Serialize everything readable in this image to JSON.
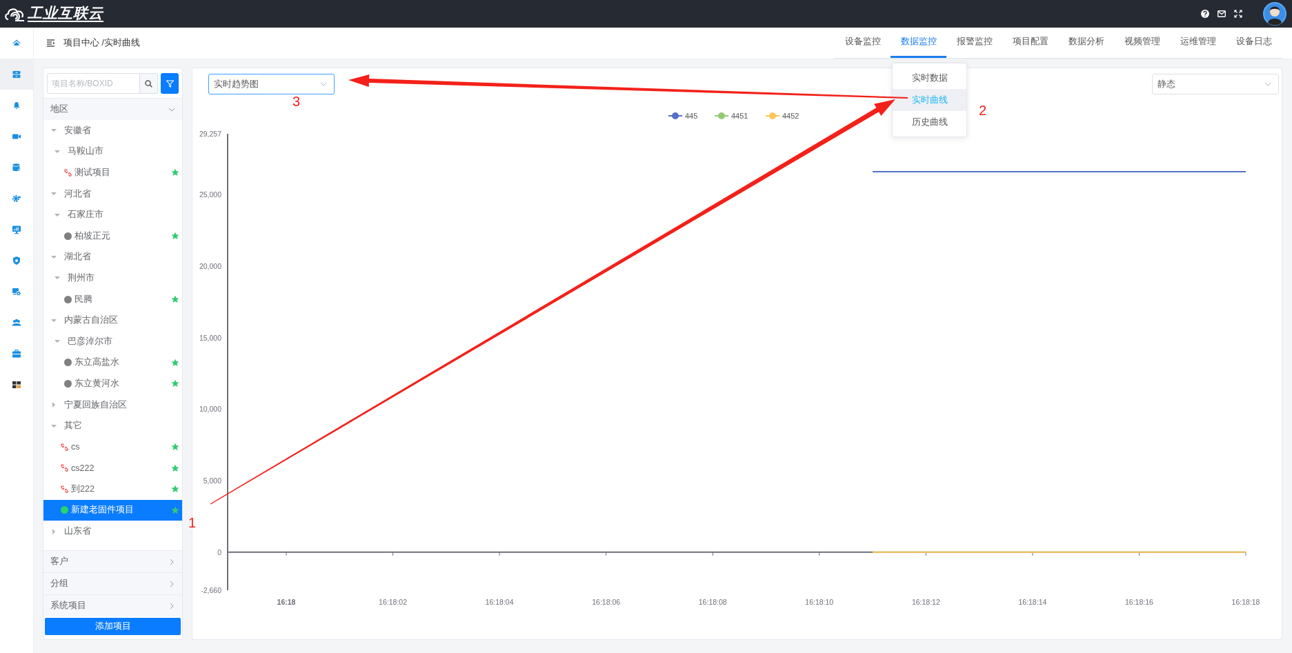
{
  "header": {
    "brand": "工业互联云"
  },
  "rail": [
    {
      "kind": "home",
      "selected": false
    },
    {
      "kind": "cabinet",
      "selected": true
    },
    {
      "kind": "bell",
      "selected": false
    },
    {
      "kind": "video",
      "selected": false
    },
    {
      "kind": "database",
      "selected": false
    },
    {
      "kind": "gear",
      "selected": false
    },
    {
      "kind": "monitor",
      "selected": false
    },
    {
      "kind": "shield",
      "selected": false
    },
    {
      "kind": "monitor-gear",
      "selected": false
    },
    {
      "kind": "users",
      "selected": false
    },
    {
      "kind": "briefcase",
      "selected": false
    },
    {
      "kind": "grid",
      "selected": false
    }
  ],
  "breadcrumb": "项目中心 /实时曲线",
  "nav": {
    "tabs": [
      {
        "label": "设备监控",
        "selected": false
      },
      {
        "label": "数据监控",
        "selected": true,
        "menu": [
          {
            "label": "实时数据",
            "selected": false
          },
          {
            "label": "实时曲线",
            "selected": true
          },
          {
            "label": "历史曲线",
            "selected": false
          }
        ]
      },
      {
        "label": "报警监控",
        "selected": false
      },
      {
        "label": "项目配置",
        "selected": false
      },
      {
        "label": "数据分析",
        "selected": false
      },
      {
        "label": "视频管理",
        "selected": false
      },
      {
        "label": "运维管理",
        "selected": false
      },
      {
        "label": "设备日志",
        "selected": false
      }
    ]
  },
  "tree_panel": {
    "search": {
      "placeholder": "项目名称/BOXID"
    },
    "sections": [
      {
        "title": "地区",
        "expanded": true,
        "nodes": [
          {
            "label": "安徽省",
            "expanded": true,
            "selected": false,
            "children": [
              {
                "label": "马鞍山市",
                "expanded": true,
                "selected": false,
                "children": [
                  {
                    "label": "测试项目",
                    "kind": "unlinked",
                    "starred": true,
                    "selected": false
                  }
                ]
              }
            ]
          },
          {
            "label": "河北省",
            "expanded": true,
            "selected": false,
            "children": [
              {
                "label": "石家庄市",
                "expanded": true,
                "selected": false,
                "children": [
                  {
                    "label": "柏坡正元",
                    "kind": "offline",
                    "starred": true,
                    "selected": false
                  }
                ]
              }
            ]
          },
          {
            "label": "湖北省",
            "expanded": true,
            "selected": false,
            "children": [
              {
                "label": "荆州市",
                "expanded": true,
                "selected": false,
                "children": [
                  {
                    "label": "民腾",
                    "kind": "offline",
                    "starred": true,
                    "selected": false
                  }
                ]
              }
            ]
          },
          {
            "label": "内蒙古自治区",
            "expanded": true,
            "selected": false,
            "children": [
              {
                "label": "巴彦淖尔市",
                "expanded": true,
                "selected": false,
                "children": [
                  {
                    "label": "东立高盐水",
                    "kind": "offline",
                    "starred": true,
                    "selected": false
                  },
                  {
                    "label": "东立黄河水",
                    "kind": "offline",
                    "starred": true,
                    "selected": false
                  }
                ]
              }
            ]
          },
          {
            "label": "宁夏回族自治区",
            "expanded": false,
            "selected": false
          },
          {
            "label": "其它",
            "expanded": true,
            "selected": false,
            "children": [
              {
                "label": "cs",
                "kind": "unlinked",
                "starred": true,
                "selected": false
              },
              {
                "label": "cs222",
                "kind": "unlinked",
                "starred": true,
                "selected": false
              },
              {
                "label": "到222",
                "kind": "unlinked",
                "starred": true,
                "selected": false
              },
              {
                "label": "新建老固件项目",
                "kind": "online",
                "starred": true,
                "selected": true
              }
            ]
          },
          {
            "label": "山东省",
            "expanded": false,
            "selected": false
          }
        ]
      },
      {
        "title": "客户",
        "expanded": false
      },
      {
        "title": "分组",
        "expanded": false
      },
      {
        "title": "系统项目",
        "expanded": false
      }
    ],
    "add_button": "添加项目"
  },
  "chart_card": {
    "view_select": {
      "value": "实时趋势图",
      "focused": true
    },
    "mode_select": {
      "value": "静态",
      "focused": false
    },
    "chart_data": {
      "type": "line",
      "legend": "top",
      "categories": [
        "16:18",
        null,
        "16:18:02",
        null,
        "16:18:04",
        null,
        "16:18:06",
        null,
        "16:18:08",
        null,
        "16:18:10",
        null,
        "16:18:12",
        null,
        "16:18:14",
        null,
        "16:18:16",
        null,
        "16:18:18"
      ],
      "series": [
        {
          "name": "445",
          "color": "#5470c6",
          "values": [
            null,
            null,
            null,
            null,
            null,
            null,
            null,
            null,
            null,
            null,
            null,
            26600,
            26600,
            26600,
            26600,
            26600,
            26600,
            26600,
            26600
          ]
        },
        {
          "name": "4451",
          "color": "#91cc75",
          "values": [
            null,
            null,
            null,
            null,
            null,
            null,
            null,
            null,
            null,
            null,
            null,
            null,
            null,
            null,
            null,
            null,
            null,
            null,
            null
          ]
        },
        {
          "name": "4452",
          "color": "#fac858",
          "values": [
            null,
            null,
            null,
            null,
            null,
            null,
            null,
            null,
            null,
            null,
            null,
            0,
            0,
            0,
            0,
            0,
            0,
            0,
            0
          ]
        }
      ],
      "ylim": [
        -2660,
        29257
      ],
      "yticks": [
        {
          "value": -2660,
          "label": "-2,660"
        },
        {
          "value": 0,
          "label": "0"
        },
        {
          "value": 5000,
          "label": "5,000"
        },
        {
          "value": 10000,
          "label": "10,000"
        },
        {
          "value": 15000,
          "label": "15,000"
        },
        {
          "value": 20000,
          "label": "20,000"
        },
        {
          "value": 25000,
          "label": "25,000"
        },
        {
          "value": 29257,
          "label": "29,257"
        }
      ]
    }
  },
  "annotations": [
    {
      "label": "1"
    },
    {
      "label": "2"
    },
    {
      "label": "3"
    }
  ]
}
